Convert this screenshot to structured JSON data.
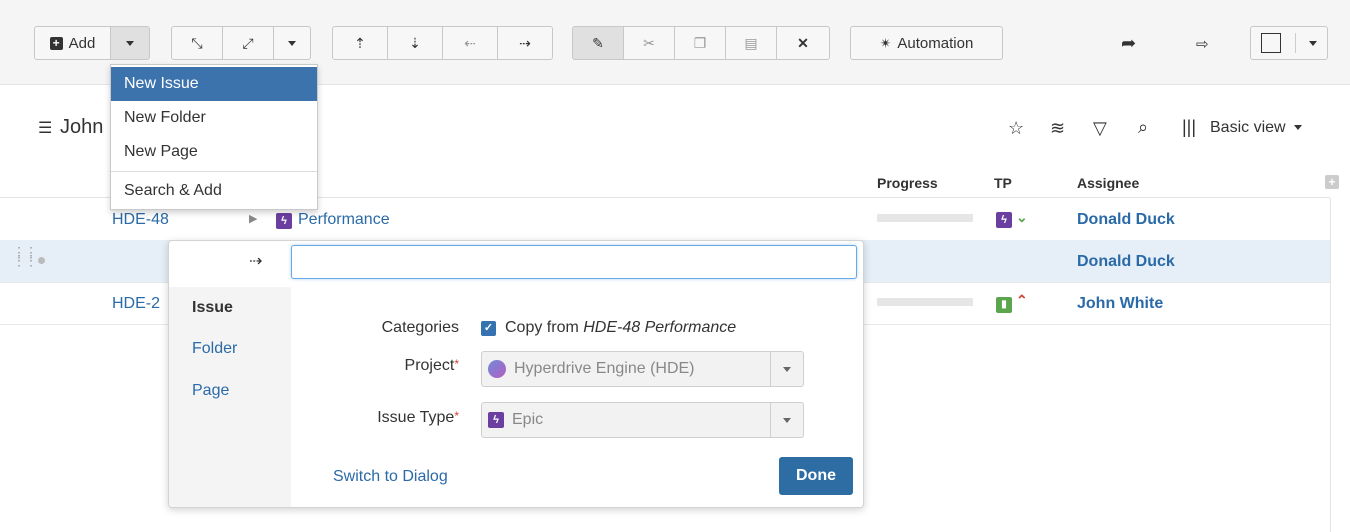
{
  "toolbar": {
    "add_label": "Add",
    "automation_label": "Automation",
    "view_selector": ""
  },
  "dropdown_menu": {
    "items": [
      "New Issue",
      "New Folder",
      "New Page",
      "Search & Add"
    ]
  },
  "structure": {
    "title": "John",
    "view_label": "Basic view"
  },
  "table": {
    "headers": {
      "progress": "Progress",
      "tp": "TP",
      "assignee": "Assignee"
    },
    "rows": [
      {
        "key": "HDE-48",
        "summary": "Performance",
        "assignee": "Donald Duck"
      },
      {
        "key": "",
        "summary": "",
        "assignee": "Donald Duck"
      },
      {
        "key": "HDE-2",
        "summary": "",
        "assignee": "John White"
      }
    ]
  },
  "popup": {
    "input_value": "",
    "tabs": [
      "Issue",
      "Folder",
      "Page"
    ],
    "categories_label": "Categories",
    "copy_prefix": "Copy from ",
    "copy_source": "HDE-48 Performance",
    "project_label": "Project",
    "project_value": "Hyperdrive Engine (HDE)",
    "issue_type_label": "Issue Type",
    "issue_type_value": "Epic",
    "switch_link": "Switch to Dialog",
    "done_label": "Done"
  },
  "colors": {
    "accent": "#3d73ad",
    "link": "#2a6aa8",
    "epic": "#6b3fa0",
    "story": "#5ba64d",
    "required": "#d04437"
  }
}
